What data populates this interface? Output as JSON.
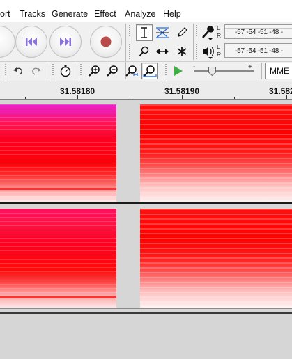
{
  "menu": {
    "items": [
      "ort",
      "Tracks",
      "Generate",
      "Effect",
      "Analyze",
      "Help"
    ]
  },
  "meters": {
    "record_scale": "-57 -54 -51 -48 -",
    "playback_scale": "-57 -54 -51 -48 -",
    "left_label": "L",
    "right_label": "R"
  },
  "toolbar": {
    "host_value": "MME",
    "slider_minus": "-",
    "slider_plus": "+"
  },
  "ruler": {
    "labels": [
      "31.58180",
      "31.58190",
      "31.582"
    ]
  },
  "colors": {
    "accent_green": "#3cb043",
    "spectrogram_red": "#ff0000",
    "spectrogram_magenta": "#ee22c8",
    "record_red": "#b84a4a",
    "transport_purple": "#8a72e0"
  }
}
